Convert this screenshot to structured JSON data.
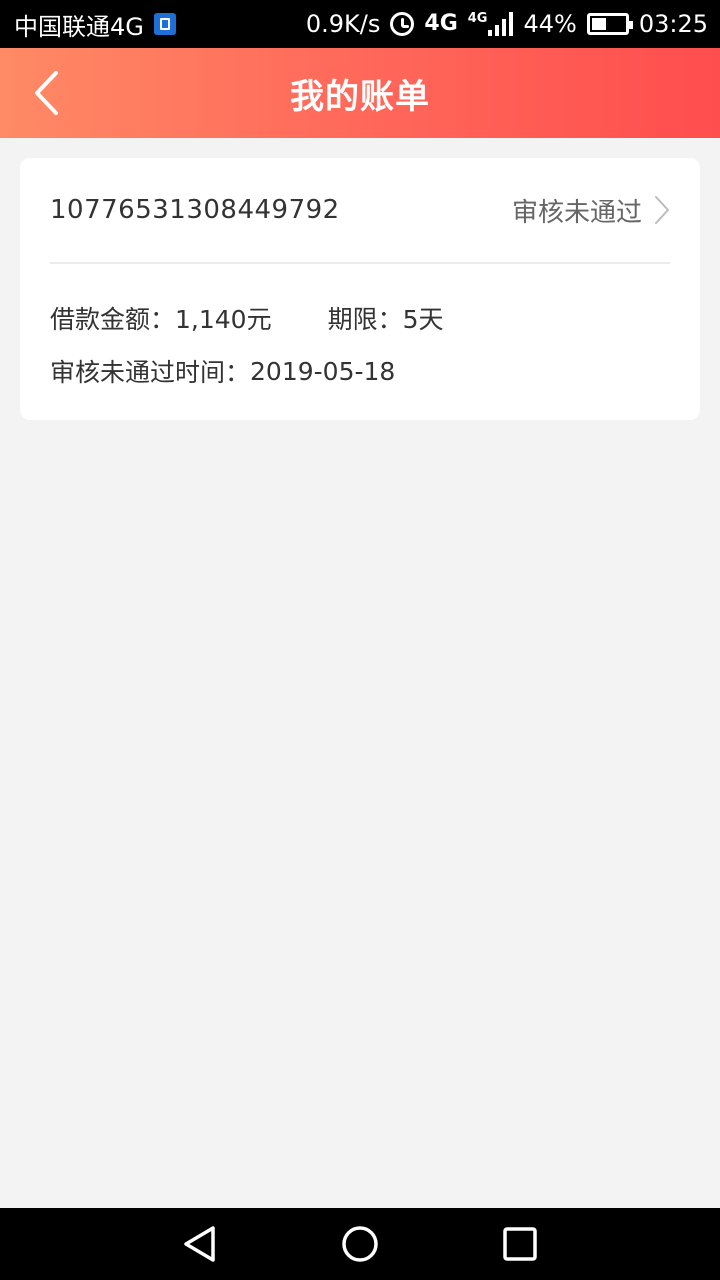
{
  "status_bar": {
    "carrier": "中国联通4G",
    "net_speed": "0.9K/s",
    "network_badge_1": "4G",
    "network_badge_2": "4G",
    "battery": "44%",
    "battery_level": 0.44,
    "time": "03:25",
    "icons": [
      "sim-icon",
      "alarm-icon",
      "signal-icon",
      "battery-icon"
    ]
  },
  "header": {
    "title": "我的账单",
    "back_icon": "chevron-left-icon",
    "gradient_colors": [
      "#ff8a65",
      "#ff4e4e"
    ]
  },
  "bill": {
    "order_number": "10776531308449792",
    "status": "审核未通过",
    "status_icon": "chevron-right-icon",
    "amount_label": "借款金额：",
    "amount_value": "1,140元",
    "term_label": "期限：",
    "term_value": "5天",
    "time_label": "审核未通过时间：",
    "time_value": "2019-05-18"
  },
  "nav_bar": {
    "buttons": [
      "back-triangle-icon",
      "home-circle-icon",
      "recent-square-icon"
    ]
  }
}
